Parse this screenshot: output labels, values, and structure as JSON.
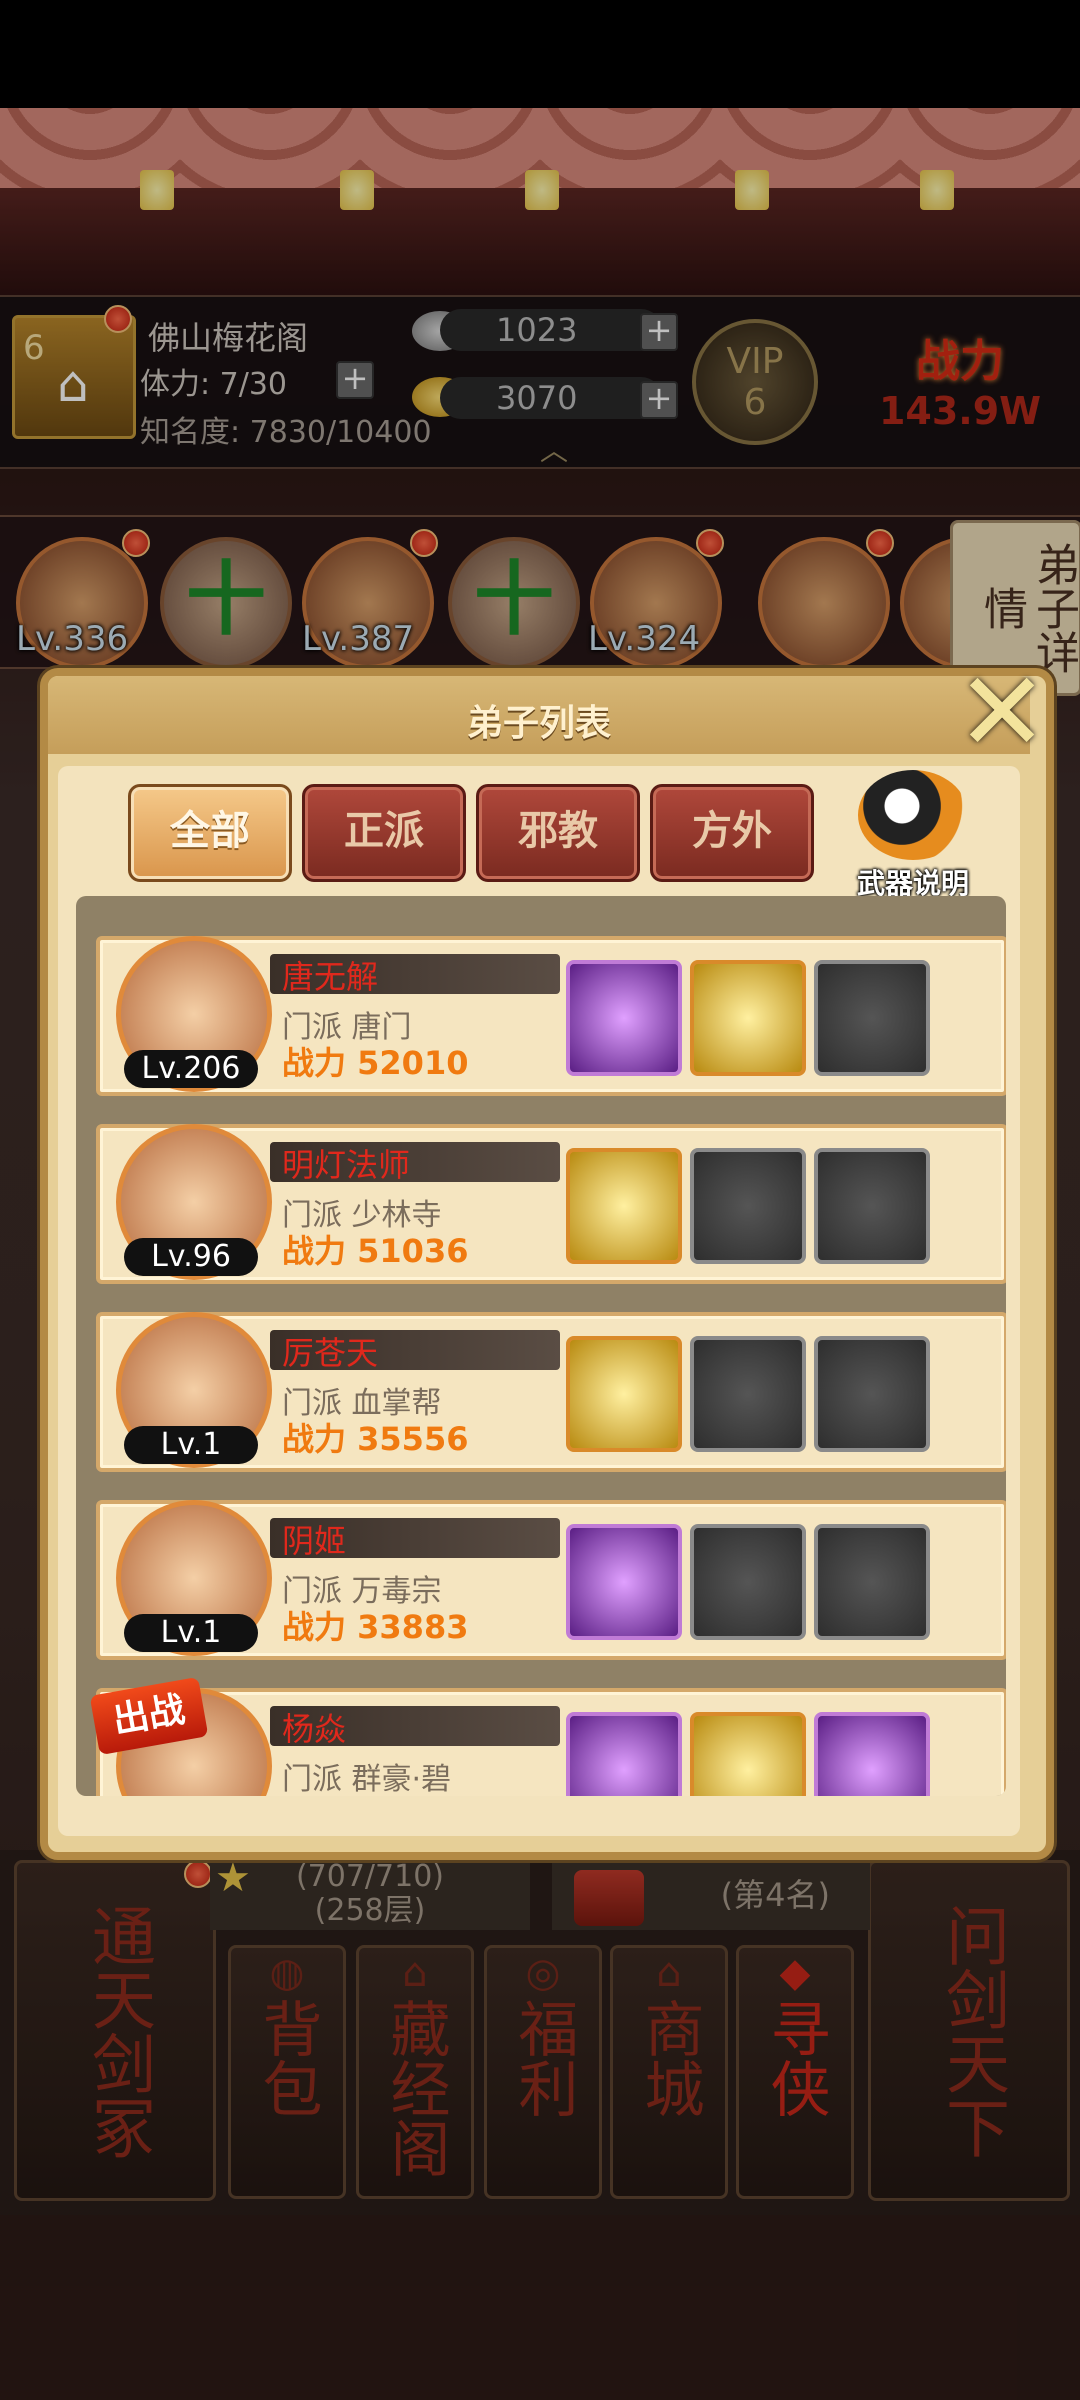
{
  "player": {
    "avatar_level": "6",
    "name": "佛山梅花阁",
    "stamina": "体力: 7/30",
    "fame": "知名度: 7830/10400",
    "silver": "1023",
    "gold": "3070",
    "vip_label": "VIP",
    "vip_level": "6",
    "power_label": "战力",
    "power_value": "143.9W"
  },
  "strip": {
    "plus_glyph": "十",
    "levels": [
      "Lv.336",
      "Lv.387",
      "Lv.324"
    ],
    "detail_tab": "弟子详情"
  },
  "modal": {
    "title": "弟子列表",
    "close_glyph": "✕",
    "tabs": [
      "全部",
      "正派",
      "邪教",
      "方外"
    ],
    "active_tab": "全部",
    "weapon_info": "武器说明"
  },
  "disciples": [
    {
      "name": "唐无解",
      "sect": "门派   唐门",
      "power": "战力 52010",
      "level": "Lv.206",
      "slots": [
        "purple",
        "gold",
        "empty"
      ]
    },
    {
      "name": "明灯法师",
      "sect": "门派   少林寺",
      "power": "战力 51036",
      "level": "Lv.96",
      "slots": [
        "gold",
        "empty",
        "empty"
      ]
    },
    {
      "name": "厉苍天",
      "sect": "门派   血掌帮",
      "power": "战力 35556",
      "level": "Lv.1",
      "slots": [
        "gold",
        "empty",
        "empty"
      ]
    },
    {
      "name": "阴姬",
      "sect": "门派   万毒宗",
      "power": "战力 33883",
      "level": "Lv.1",
      "slots": [
        "purple",
        "empty",
        "empty"
      ]
    },
    {
      "name": "杨焱",
      "sect": "门派   群豪·碧",
      "badge": "出战",
      "slots": [
        "purple",
        "gold",
        "purple"
      ]
    }
  ],
  "bottom": {
    "left_big": "通天剑冢",
    "right_big": "问剑天下",
    "tower_progress": "(707/710)",
    "tower_floor": "(258层)",
    "rank": "(第4名)",
    "buttons": [
      "背包",
      "藏经阁",
      "福利",
      "商城",
      "寻侠"
    ]
  },
  "colors": {
    "accent_red": "#e0281c",
    "power_orange": "#f07a10",
    "panel": "#f3e3bd"
  }
}
